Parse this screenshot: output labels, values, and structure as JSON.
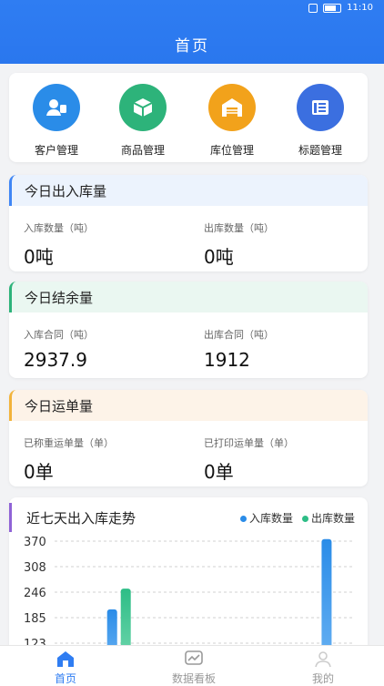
{
  "status_bar": {
    "time": "11:10"
  },
  "header": {
    "title": "首页"
  },
  "quick_actions": [
    {
      "label": "客户管理",
      "icon": "customer-icon",
      "color": "#2a8ce8"
    },
    {
      "label": "商品管理",
      "icon": "product-box-icon",
      "color": "#2db37a"
    },
    {
      "label": "库位管理",
      "icon": "warehouse-icon",
      "color": "#f2a21b"
    },
    {
      "label": "标题管理",
      "icon": "list-card-icon",
      "color": "#3b6fe0"
    }
  ],
  "inout": {
    "title": "今日出入库量",
    "in_label": "入库数量（吨）",
    "in_value": "0吨",
    "out_label": "出库数量（吨）",
    "out_value": "0吨",
    "accent": "#3f86f5"
  },
  "balance": {
    "title": "今日结余量",
    "in_label": "入库合同（吨）",
    "in_value": "2937.9",
    "out_label": "出库合同（吨）",
    "out_value": "1912",
    "accent": "#2db37a"
  },
  "waybill": {
    "title": "今日运单量",
    "weighed_label": "已称重运单量（单）",
    "weighed_value": "0单",
    "printed_label": "已打印运单量（单）",
    "printed_value": "0单",
    "accent": "#f2b33a"
  },
  "chart_section": {
    "title": "近七天出入库走势",
    "accent": "#8f63d6"
  },
  "chart_data": {
    "type": "bar",
    "title": "近七天出入库走势",
    "y_ticks": [
      "370",
      "308",
      "246",
      "185",
      "123"
    ],
    "series": [
      {
        "name": "入库数量",
        "color": "#2a8ce8",
        "values": [
          null,
          205,
          null,
          null,
          null,
          null,
          375
        ]
      },
      {
        "name": "出库数量",
        "color": "#2dbd86",
        "values": [
          null,
          255,
          null,
          null,
          null,
          null,
          null
        ]
      }
    ],
    "ylim": [
      123,
      370
    ],
    "grid": true,
    "legend": "top-right"
  },
  "tabs": [
    {
      "label": "首页",
      "icon": "home-icon",
      "active": true
    },
    {
      "label": "数据看板",
      "icon": "dashboard-chart-icon",
      "active": false
    },
    {
      "label": "我的",
      "icon": "profile-icon",
      "active": false
    }
  ]
}
